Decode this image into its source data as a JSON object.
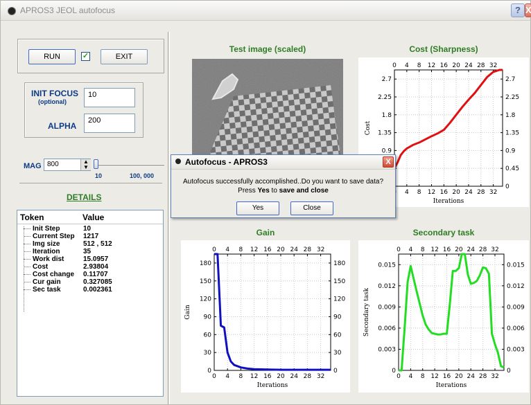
{
  "window": {
    "title": "APROS3 JEOL autofocus",
    "help_label": "?",
    "close_label": "X"
  },
  "controls": {
    "run_label": "RUN",
    "run_checked": true,
    "check_mark": "✓",
    "exit_label": "EXIT",
    "init_focus_label": "INIT FOCUS",
    "init_focus_sub": "(optional)",
    "init_focus_value": "10",
    "alpha_label": "ALPHA",
    "alpha_value": "200",
    "mag_label": "MAG",
    "mag_value": "800",
    "slider_min": "10",
    "slider_max": "100, 000",
    "slider_level": 0
  },
  "details": {
    "title": "DETAILS",
    "columns": [
      "Token",
      "Value"
    ],
    "rows": [
      {
        "token": "Init Step",
        "value": "10"
      },
      {
        "token": "Current Step",
        "value": "1217"
      },
      {
        "token": "Img size",
        "value": "512 , 512"
      },
      {
        "token": "Iteration",
        "value": "35"
      },
      {
        "token": "Work dist",
        "value": "15.0957"
      },
      {
        "token": "Cost",
        "value": "2.93804"
      },
      {
        "token": "Cost change",
        "value": "0.11707"
      },
      {
        "token": "Cur gain",
        "value": "0.327085"
      },
      {
        "token": "Sec task",
        "value": "0.002361"
      }
    ]
  },
  "panels": {
    "test_image_title": "Test image (scaled)",
    "cost_title": "Cost (Sharpness)",
    "gain_title": "Gain",
    "secondary_title": "Secondary task"
  },
  "dialog": {
    "title": "Autofocus - APROS3",
    "line1": "Autofocus successfully accomplished..Do you want to save data?",
    "line2_pre": "Press ",
    "line2_yes": "Yes",
    "line2_mid": " to ",
    "line2_bold": "save and close",
    "yes_label": "Yes",
    "close_label": "Close",
    "close_icon": "X"
  },
  "chart_data": [
    {
      "type": "line",
      "ylabel": "Cost",
      "xlabel": "Iterations",
      "xlim": [
        0,
        35
      ],
      "ylim": [
        0,
        2.93
      ],
      "xticks": [
        0,
        4,
        8,
        12,
        16,
        20,
        24,
        28,
        32
      ],
      "yticks": [
        0,
        0.45,
        0.9,
        1.35,
        1.8,
        2.25,
        2.7
      ],
      "ytick_labels": [
        "0",
        "0.45",
        "0.9",
        "1.35",
        "1.8",
        "2.25",
        "2.7"
      ],
      "color": "#e01010",
      "series": [
        {
          "x": [
            0,
            1,
            2,
            3,
            4,
            6,
            8,
            10,
            12,
            14,
            16,
            18,
            20,
            22,
            24,
            26,
            28,
            30,
            32,
            34,
            35
          ],
          "y": [
            0.45,
            0.6,
            0.78,
            0.88,
            0.95,
            1.04,
            1.1,
            1.18,
            1.26,
            1.33,
            1.42,
            1.6,
            1.8,
            2.0,
            2.18,
            2.35,
            2.55,
            2.75,
            2.88,
            2.93,
            2.93
          ]
        }
      ]
    },
    {
      "type": "line",
      "ylabel": "Gain",
      "xlabel": "Iterations",
      "xlim": [
        0,
        35
      ],
      "ylim": [
        0,
        195
      ],
      "xticks": [
        0,
        4,
        8,
        12,
        16,
        20,
        24,
        28,
        32
      ],
      "yticks": [
        0,
        30,
        60,
        90,
        120,
        150,
        180
      ],
      "ytick_labels": [
        "0",
        "30",
        "60",
        "90",
        "120",
        "150",
        "180"
      ],
      "color": "#1010c0",
      "series": [
        {
          "x": [
            0,
            1,
            2,
            3,
            4,
            5,
            6,
            8,
            10,
            12,
            16,
            20,
            24,
            28,
            32,
            35
          ],
          "y": [
            195,
            195,
            75,
            72,
            30,
            15,
            9,
            5,
            3,
            2,
            1.5,
            1,
            1,
            1,
            1,
            1
          ]
        }
      ]
    },
    {
      "type": "line",
      "ylabel": "Secondary task",
      "xlabel": "Iterations",
      "xlim": [
        0,
        35
      ],
      "ylim": [
        0,
        0.0165
      ],
      "xticks": [
        0,
        4,
        8,
        12,
        16,
        20,
        24,
        28,
        32
      ],
      "yticks": [
        0,
        0.003,
        0.006,
        0.009,
        0.012,
        0.015
      ],
      "ytick_labels": [
        "0",
        "0.003",
        "0.006",
        "0.009",
        "0.012",
        "0.015"
      ],
      "color": "#22dd22",
      "series": [
        {
          "x": [
            0,
            1,
            2,
            3,
            4,
            6,
            8,
            9,
            10,
            11,
            12,
            13,
            14,
            15,
            16,
            17,
            18,
            19,
            20,
            21,
            22,
            23,
            24,
            25,
            26,
            27,
            28,
            29,
            30,
            31,
            32,
            33,
            34,
            35
          ],
          "y": [
            0,
            0,
            0.006,
            0.0125,
            0.0148,
            0.0112,
            0.0078,
            0.0065,
            0.0058,
            0.0053,
            0.0052,
            0.0051,
            0.0051,
            0.0052,
            0.0052,
            0.0093,
            0.0141,
            0.0141,
            0.0145,
            0.0165,
            0.0165,
            0.0136,
            0.0123,
            0.0124,
            0.0127,
            0.0135,
            0.0146,
            0.0145,
            0.0137,
            0.0052,
            0.0037,
            0.0025,
            0.0006,
            0.0004
          ]
        }
      ]
    }
  ]
}
